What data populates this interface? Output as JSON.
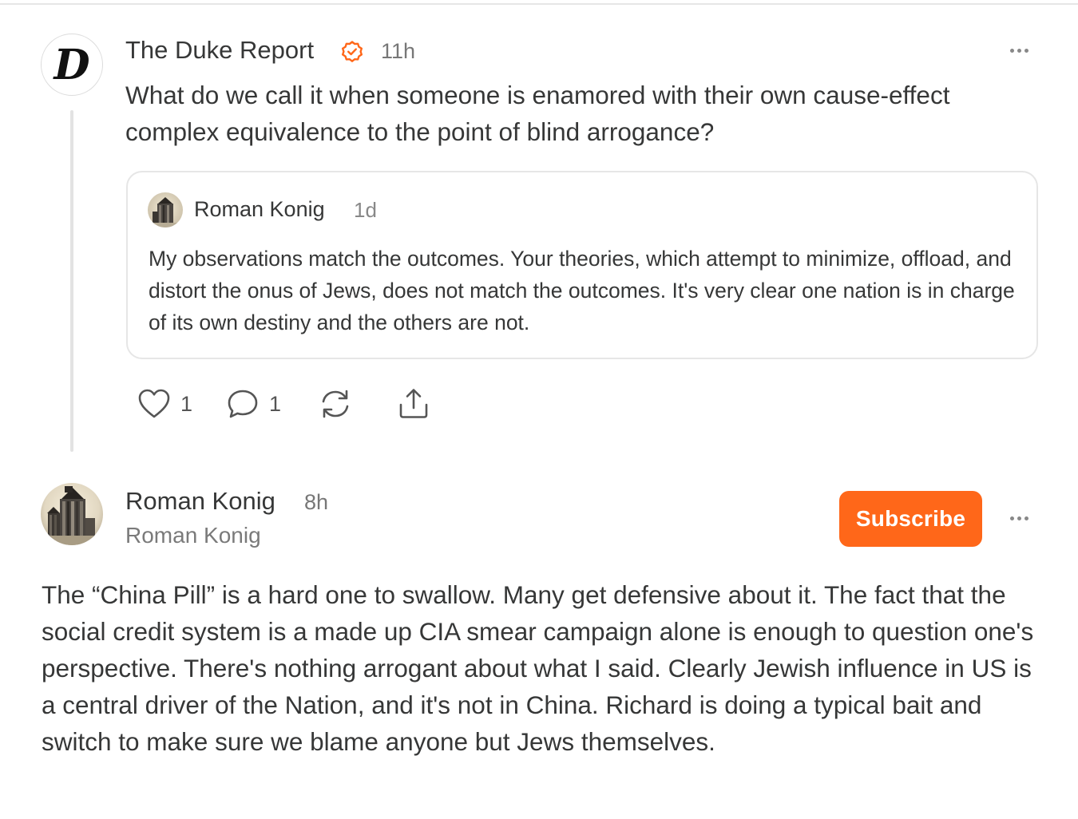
{
  "post": {
    "author": "The Duke Report",
    "avatar_letter": "D",
    "time": "11h",
    "text": "What do we call it when someone is enamored with their own cause-effect complex equivalence to the point of blind arrogance?",
    "quote": {
      "author": "Roman Konig",
      "time": "1d",
      "text": "My observations match the outcomes. Your theories, which attempt to minimize, offload, and distort the onus of Jews, does not match the outcomes. It's very clear one nation is in charge of its own destiny and the others are not."
    },
    "actions": {
      "likes": "1",
      "comments": "1"
    }
  },
  "reply": {
    "author": "Roman Konig",
    "time": "8h",
    "publication": "Roman Konig",
    "subscribe_label": "Subscribe",
    "text": "The “China Pill” is a hard one to swallow. Many get defensive about it. The fact that the social credit system is a made up CIA smear campaign alone is enough to question one's perspective. There's nothing arrogant about what I said. Clearly Jewish influence in US is a central driver of the Nation, and it's not in China. Richard is doing a typical bait and switch to make sure we blame anyone but Jews themselves."
  },
  "colors": {
    "accent": "#ff6719",
    "text": "#363737",
    "muted": "#777777",
    "border": "#e6e6e6"
  },
  "icons": [
    "verified-icon",
    "more-icon",
    "heart-icon",
    "comment-icon",
    "restack-icon",
    "share-icon"
  ]
}
